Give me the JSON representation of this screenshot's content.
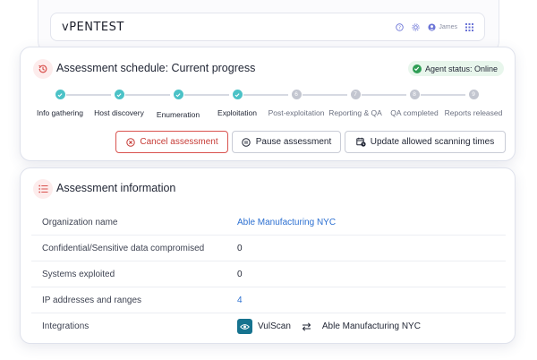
{
  "app": {
    "logo": "vPENTEST",
    "user_name": "James"
  },
  "progress": {
    "title": "Assessment schedule: Current progress",
    "agent_status": "Agent status: Online",
    "steps": [
      {
        "label": "Info gathering",
        "marker": "",
        "done": true
      },
      {
        "label": "Host discovery",
        "marker": "",
        "done": true
      },
      {
        "label": "Enumeration",
        "marker": "",
        "done": true
      },
      {
        "label": "Exploitation",
        "marker": "",
        "done": true
      },
      {
        "label": "Post-exploitation",
        "marker": "6",
        "done": false
      },
      {
        "label": "Reporting & QA",
        "marker": "7",
        "done": false
      },
      {
        "label": "QA completed",
        "marker": "8",
        "done": false
      },
      {
        "label": "Reports released",
        "marker": "9",
        "done": false
      }
    ],
    "buttons": {
      "cancel": "Cancel assessment",
      "pause": "Pause assessment",
      "update": "Update allowed scanning times"
    }
  },
  "info": {
    "title": "Assessment information",
    "rows": [
      {
        "label": "Organization name",
        "value": "Able Manufacturing NYC"
      },
      {
        "label": "Confidential/Sensitive data compromised",
        "value": "0"
      },
      {
        "label": "Systems exploited",
        "value": "0"
      },
      {
        "label": "IP addresses and ranges",
        "value": "4"
      },
      {
        "label": "Integrations",
        "integration_name": "VulScan",
        "integration_target": "Able Manufacturing NYC"
      }
    ]
  },
  "colors": {
    "accent_teal": "#4cc2c7",
    "danger": "#c63b36",
    "link": "#2b6fd1",
    "online_green": "#2f9e55"
  }
}
